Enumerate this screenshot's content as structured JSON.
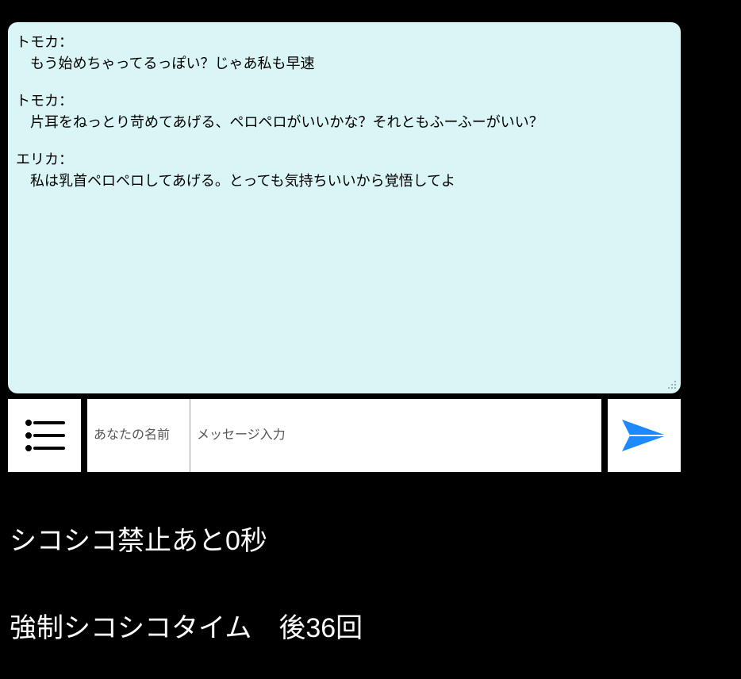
{
  "chat": {
    "messages": [
      {
        "speaker": "トモカ：",
        "body": "もう始めちゃってるっぽい？じゃあ私も早速"
      },
      {
        "speaker": "トモカ：",
        "body": "片耳をねっとり苛めてあげる、ペロペロがいいかな？それともふーふーがいい？"
      },
      {
        "speaker": "エリカ：",
        "body": "私は乳首ペロペロしてあげる。とっても気持ちいいから覚悟してよ"
      }
    ]
  },
  "input_bar": {
    "name_placeholder": "あなたの名前",
    "message_placeholder": "メッセージ入力"
  },
  "status": {
    "line1": "シコシコ禁止あと0秒",
    "line2": "強制シコシコタイム　後36回"
  }
}
